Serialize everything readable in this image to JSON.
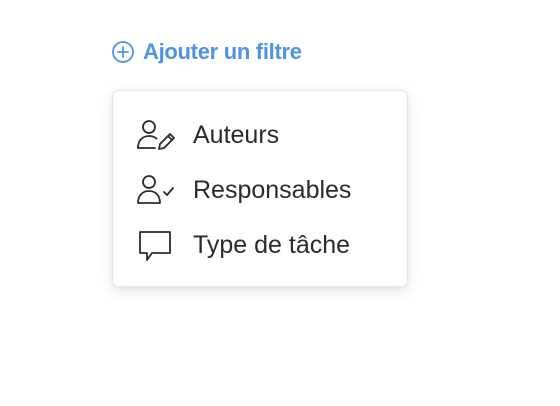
{
  "add_filter": {
    "label": "Ajouter un filtre",
    "icon": "plus-circle-icon",
    "color": "#4f93e6"
  },
  "menu": {
    "items": [
      {
        "label": "Auteurs",
        "icon": "user-edit-icon"
      },
      {
        "label": "Responsables",
        "icon": "user-check-icon"
      },
      {
        "label": "Type de tâche",
        "icon": "speech-bubble-icon"
      }
    ]
  }
}
